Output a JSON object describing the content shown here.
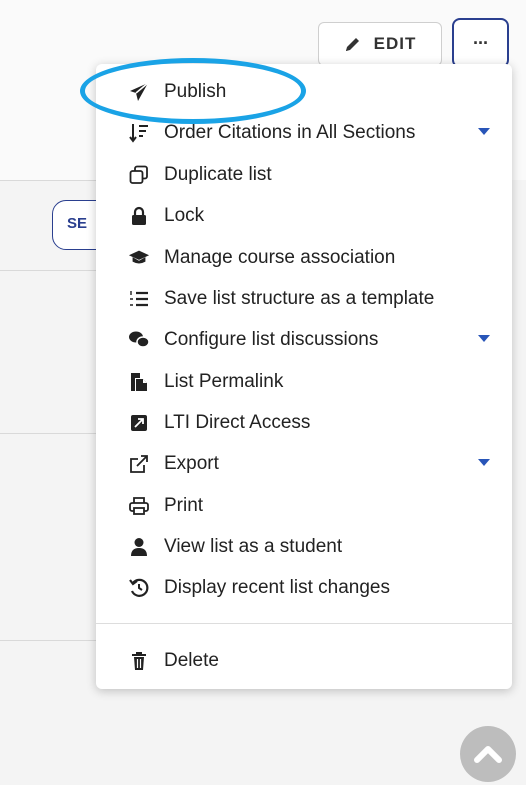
{
  "toolbar": {
    "edit_label": "EDIT",
    "more_label": "···"
  },
  "search_button": {
    "label": "SE"
  },
  "menu": {
    "items": [
      {
        "label": "Publish",
        "icon": "paper-plane-icon"
      },
      {
        "label": "Order Citations in All Sections",
        "icon": "sort-icon",
        "has_submenu": true
      },
      {
        "label": "Duplicate list",
        "icon": "duplicate-icon"
      },
      {
        "label": "Lock",
        "icon": "lock-icon"
      },
      {
        "label": "Manage course association",
        "icon": "graduation-cap-icon"
      },
      {
        "label": "Save list structure as a template",
        "icon": "list-ol-icon"
      },
      {
        "label": "Configure list discussions",
        "icon": "comments-icon",
        "has_submenu": true
      },
      {
        "label": "List Permalink",
        "icon": "permalink-icon"
      },
      {
        "label": "LTI Direct Access",
        "icon": "external-box-icon"
      },
      {
        "label": "Export",
        "icon": "export-icon",
        "has_submenu": true
      },
      {
        "label": "Print",
        "icon": "print-icon"
      },
      {
        "label": "View list as a student",
        "icon": "user-icon"
      },
      {
        "label": "Display recent list changes",
        "icon": "history-icon"
      },
      {
        "label": "Delete",
        "icon": "trash-icon"
      }
    ]
  },
  "colors": {
    "accent": "#2855b8",
    "highlight_ring": "#1aa3e6",
    "more_button_border": "#2a3f8f"
  }
}
